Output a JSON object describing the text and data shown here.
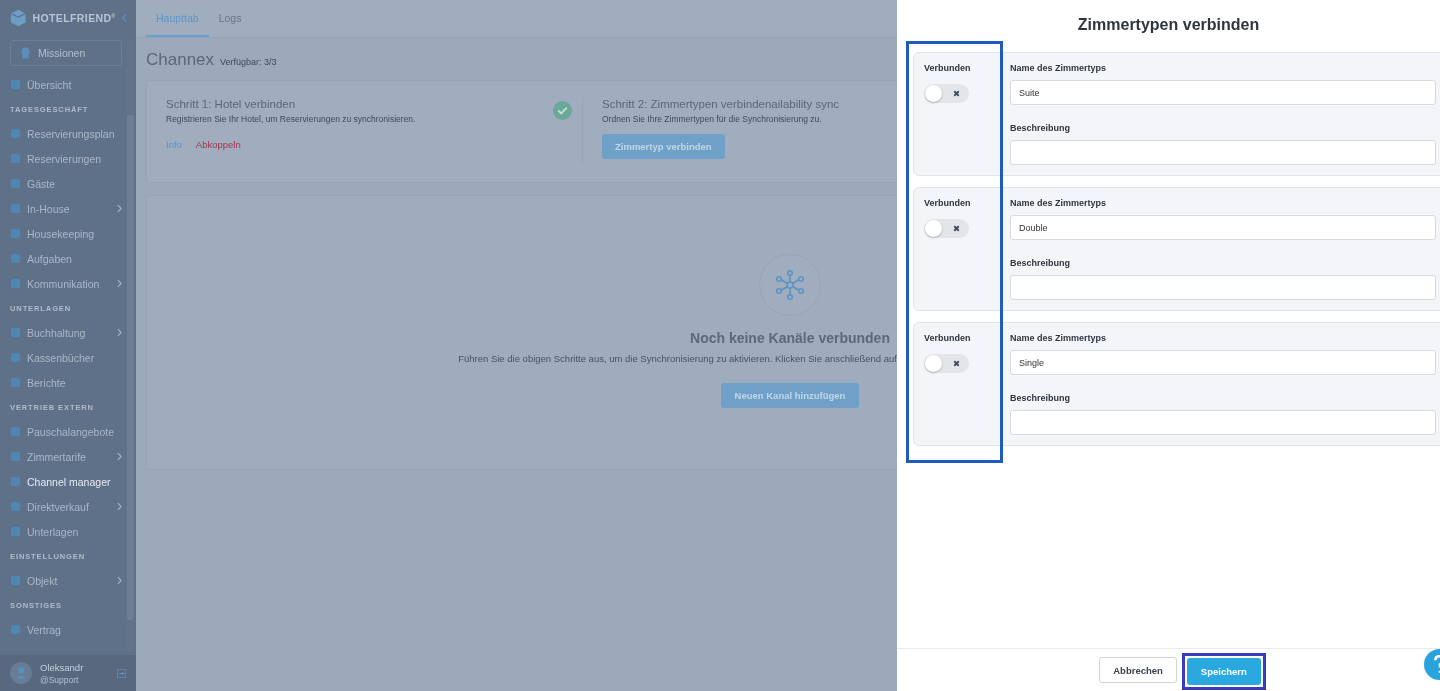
{
  "sidebar": {
    "brand": "HOTELFRIEND$^{®}$",
    "missions_button": "Missionen",
    "entries": [
      {
        "kind": "item",
        "label": "Übersicht",
        "selected": false,
        "submenu": false
      },
      {
        "kind": "header",
        "label": "TAGESGESCHÄFT"
      },
      {
        "kind": "item",
        "label": "Reservierungsplan",
        "selected": false,
        "submenu": false
      },
      {
        "kind": "item",
        "label": "Reservierungen",
        "selected": false,
        "submenu": false
      },
      {
        "kind": "item",
        "label": "Gäste",
        "selected": false,
        "submenu": false
      },
      {
        "kind": "item",
        "label": "In-House",
        "selected": false,
        "submenu": true
      },
      {
        "kind": "item",
        "label": "Housekeeping",
        "selected": false,
        "submenu": false
      },
      {
        "kind": "item",
        "label": "Aufgaben",
        "selected": false,
        "submenu": false
      },
      {
        "kind": "item",
        "label": "Kommunikation",
        "selected": false,
        "submenu": true
      },
      {
        "kind": "header",
        "label": "UNTERLAGEN"
      },
      {
        "kind": "item",
        "label": "Buchhaltung",
        "selected": false,
        "submenu": true
      },
      {
        "kind": "item",
        "label": "Kassenbücher",
        "selected": false,
        "submenu": false
      },
      {
        "kind": "item",
        "label": "Berichte",
        "selected": false,
        "submenu": false
      },
      {
        "kind": "header",
        "label": "VERTRIEB EXTERN"
      },
      {
        "kind": "item",
        "label": "Pauschalangebote",
        "selected": false,
        "submenu": false
      },
      {
        "kind": "item",
        "label": "Zimmertarife",
        "selected": false,
        "submenu": true
      },
      {
        "kind": "item",
        "label": "Channel manager",
        "selected": true,
        "submenu": false
      },
      {
        "kind": "item",
        "label": "Direktverkauf",
        "selected": false,
        "submenu": true
      },
      {
        "kind": "item",
        "label": "Unterlagen",
        "selected": false,
        "submenu": false
      },
      {
        "kind": "header",
        "label": "EINSTELLUNGEN"
      },
      {
        "kind": "item",
        "label": "Objekt",
        "selected": false,
        "submenu": true
      },
      {
        "kind": "header",
        "label": "SONSTIGES"
      },
      {
        "kind": "item",
        "label": "Vertrag",
        "selected": false,
        "submenu": false
      }
    ],
    "user": {
      "name": "Oleksandr",
      "role": "@Support"
    }
  },
  "tabs": [
    {
      "label": "Haupttab",
      "selected": true
    },
    {
      "label": "Logs",
      "selected": false
    }
  ],
  "page": {
    "title": "Channex",
    "availability": "Verfügbar: 3/3"
  },
  "steps": [
    {
      "title": "Schritt 1: Hotel verbinden",
      "description": "Registrieren Sie Ihr Hotel, um Reservierungen zu synchronisieren.",
      "done": true,
      "links": [
        {
          "label": "Info",
          "kind": "info"
        },
        {
          "label": "Abkoppeln",
          "kind": "danger"
        }
      ]
    },
    {
      "title": "Schritt 2: Zimmertypen verbindenailability sync",
      "description": "Ordnen Sie Ihre Zimmertypen für die Synchronisierung zu.",
      "done": false,
      "button": "Zimmertyp verbinden"
    }
  ],
  "empty_state": {
    "title": "Noch keine Kanäle verbunden",
    "description": "Führen Sie die obigen Schritte aus, um die Synchronisierung zu aktivieren. Klicken Sie anschließend auf",
    "button": "Neuen Kanal hinzufügen"
  },
  "drawer": {
    "title": "Zimmertypen verbinden",
    "room_types": [
      {
        "connected_label": "Verbunden",
        "connected": false,
        "name_label": "Name des Zimmertyps",
        "name": "Suite",
        "description_label": "Beschreibung"
      },
      {
        "connected_label": "Verbunden",
        "connected": false,
        "name_label": "Name des Zimmertyps",
        "name": "Double",
        "description_label": "Beschreibung"
      },
      {
        "connected_label": "Verbunden",
        "connected": false,
        "name_label": "Name des Zimmertyps",
        "name": "Single",
        "description_label": "Beschreibung"
      }
    ],
    "cancel_button": "Abbrechen",
    "save_button": "Speichern"
  }
}
